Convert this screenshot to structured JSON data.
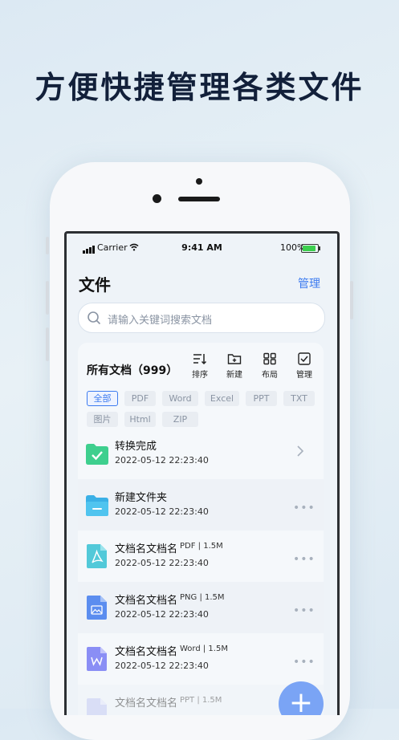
{
  "headline": "方便快捷管理各类文件",
  "status_bar": {
    "carrier": "Carrier",
    "time": "9:41 AM",
    "battery": "100%"
  },
  "header": {
    "title": "文件",
    "action": "管理"
  },
  "search": {
    "placeholder": "请输入关键词搜索文档"
  },
  "panel": {
    "title": "所有文档（999）",
    "tools": [
      "排序",
      "新建",
      "布局",
      "管理"
    ],
    "filters": [
      "全部",
      "PDF",
      "Word",
      "Excel",
      "PPT",
      "TXT",
      "图片",
      "Html",
      "ZIP"
    ],
    "active_filter": "全部"
  },
  "files": [
    {
      "name": "转换完成",
      "meta": "",
      "date": "2022-05-12   22:23:40",
      "icon": "folder-check-icon",
      "action": "chevron"
    },
    {
      "name": "新建文件夹",
      "meta": "",
      "date": "2022-05-12   22:23:40",
      "icon": "folder-icon",
      "action": "more"
    },
    {
      "name": "文档名文档名",
      "meta": "PDF | 1.5M",
      "date": "2022-05-12   22:23:40",
      "icon": "pdf-file-icon",
      "action": "more"
    },
    {
      "name": "文档名文档名",
      "meta": "PNG | 1.5M",
      "date": "2022-05-12   22:23:40",
      "icon": "image-file-icon",
      "action": "more"
    },
    {
      "name": "文档名文档名",
      "meta": "Word | 1.5M",
      "date": "2022-05-12   22:23:40",
      "icon": "word-file-icon",
      "action": "more"
    },
    {
      "name": "文档名文档名",
      "meta": "PPT | 1.5M",
      "date": "",
      "icon": "ppt-file-icon",
      "action": "more"
    }
  ],
  "fab": "+",
  "colors": {
    "accent": "#3c7bf0",
    "folder_green": "#3ecf8e",
    "folder_blue": "#3ab0e6",
    "pdf": "#52c9d9",
    "png": "#5b8def",
    "word": "#8a8ef5",
    "ppt": "#b8c0f0"
  }
}
